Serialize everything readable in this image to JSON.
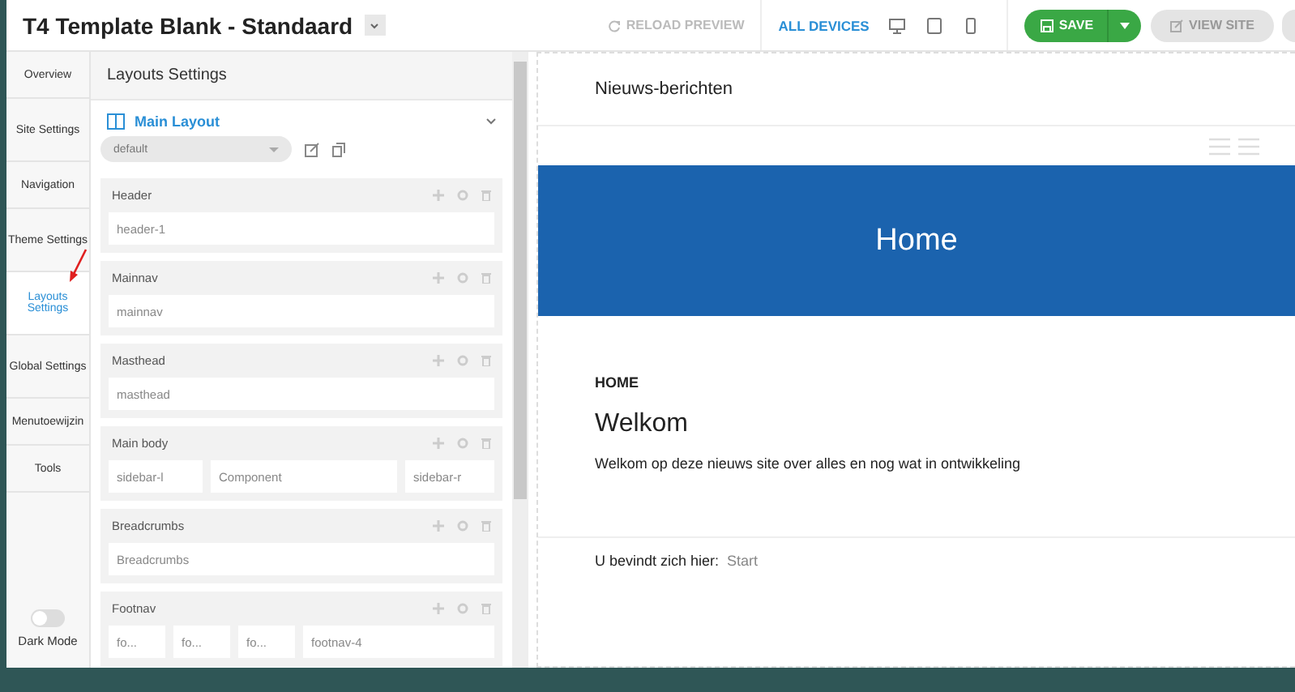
{
  "app": {
    "title": "T4 Template Blank - Standaard"
  },
  "toolbar": {
    "reload": {
      "label": "RELOAD PREVIEW",
      "disabled": true
    },
    "devices": [
      {
        "kind": "all",
        "label": "ALL DEVICES",
        "selected": true
      },
      {
        "kind": "desktop",
        "selected": false
      },
      {
        "kind": "tablet",
        "selected": false
      },
      {
        "kind": "phone",
        "selected": false
      }
    ],
    "save": {
      "label": "SAVE"
    },
    "view_site": {
      "label": "VIEW SITE"
    }
  },
  "sidebar": {
    "items": [
      {
        "label": "Overview",
        "selected": false
      },
      {
        "label": "Site Settings",
        "selected": false
      },
      {
        "label": "Navigation",
        "selected": false
      },
      {
        "label": "Theme Settings",
        "selected": false
      },
      {
        "label": "Layouts Settings",
        "selected": true
      },
      {
        "label": "Global Settings",
        "selected": false
      },
      {
        "label": "Menutoewijzin",
        "selected": false
      },
      {
        "label": "Tools",
        "selected": false
      }
    ],
    "dark_mode": {
      "label": "Dark Mode",
      "on": false
    }
  },
  "panel": {
    "title": "Layouts Settings",
    "layout": {
      "name": "Main Layout",
      "expanded": true,
      "preset": "default"
    },
    "sections": [
      {
        "name": "Header",
        "positions": [
          "header-1"
        ]
      },
      {
        "name": "Mainnav",
        "positions": [
          "mainnav"
        ]
      },
      {
        "name": "Masthead",
        "positions": [
          "masthead"
        ]
      },
      {
        "name": "Main body",
        "positions": [
          "sidebar-l",
          "Component",
          "sidebar-r"
        ]
      },
      {
        "name": "Breadcrumbs",
        "positions": [
          "Breadcrumbs"
        ]
      },
      {
        "name": "Footnav",
        "positions": [
          "fo...",
          "fo...",
          "fo...",
          "footnav-4"
        ]
      }
    ]
  },
  "preview": {
    "site_name": "Nieuws-berichten",
    "banner": "Home",
    "category": "HOME",
    "heading": "Welkom",
    "text": "Welkom op deze nieuws site over alles en nog wat in ontwikkeling",
    "breadcrumb_label": "U bevindt zich hier:",
    "breadcrumb_item": "Start"
  }
}
